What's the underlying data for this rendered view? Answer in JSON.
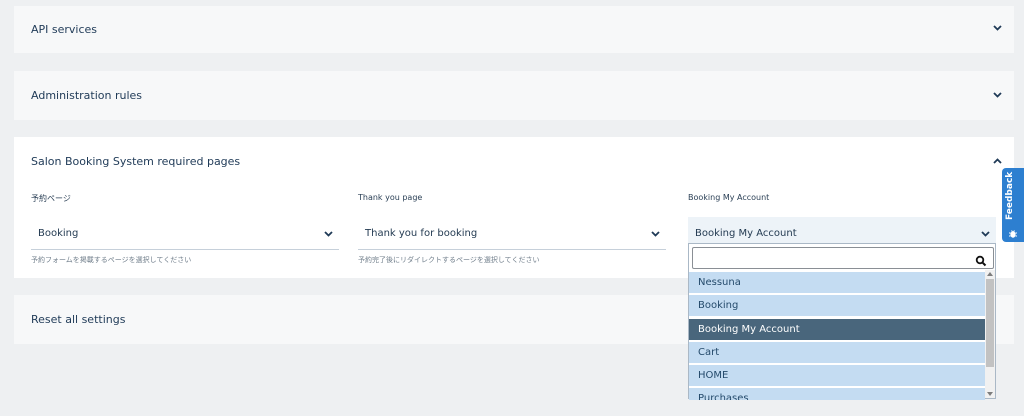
{
  "sections": {
    "api_services": {
      "title": "API services"
    },
    "administration_rules": {
      "title": "Administration rules"
    },
    "required_pages": {
      "title": "Salon Booking System required pages",
      "fields": [
        {
          "label": "予約ページ",
          "value": "Booking",
          "help": "予約フォームを掲載するページを選択してください"
        },
        {
          "label": "Thank you page",
          "value": "Thank you for booking",
          "help": "予約完了後にリダイレクトするページを選択してください"
        },
        {
          "label": "Booking My Account",
          "value": "Booking My Account",
          "help": ""
        }
      ]
    },
    "reset_settings": {
      "title": "Reset all settings"
    }
  },
  "dropdown": {
    "search_value": "",
    "options": [
      "Nessuna",
      "Booking",
      "Booking My Account",
      "Cart",
      "HOME",
      "Purchases"
    ],
    "selected": "Booking My Account"
  },
  "feedback": {
    "label": "Feedback"
  },
  "icons": {
    "chevron": "chevron-down-icon",
    "search": "search-icon",
    "feedback": "bug-icon"
  },
  "colors": {
    "accent": "#2d7fd0",
    "selected_option": "#49667c",
    "option_bg": "#c4dcf2"
  }
}
